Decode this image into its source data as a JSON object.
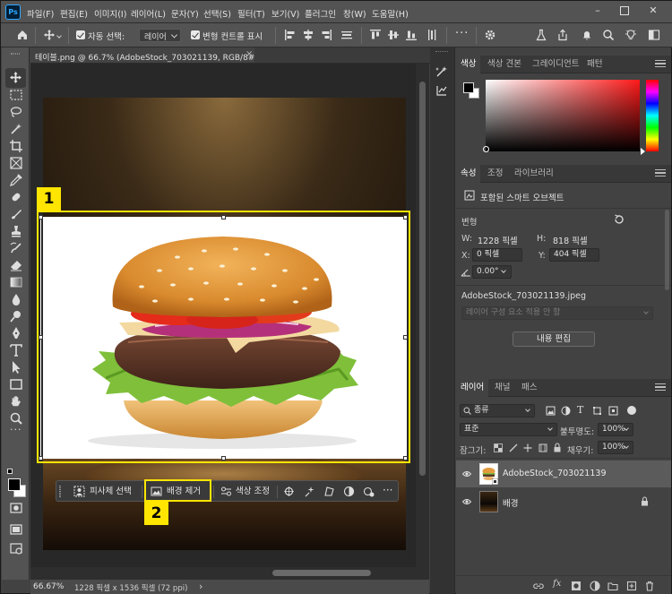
{
  "menu": [
    "파일(F)",
    "편집(E)",
    "이미지(I)",
    "레이어(L)",
    "문자(Y)",
    "선택(S)",
    "필터(T)",
    "보기(V)",
    "플러그인",
    "창(W)",
    "도움말(H)"
  ],
  "options": {
    "auto_select_label": "자동 선택:",
    "auto_select_value": "레이어",
    "transform_controls_label": "변형 컨트롤 표시"
  },
  "document_tab": {
    "title": "테이블.png @ 66.7% (AdobeStock_703021139, RGB/8#) *",
    "close": "×"
  },
  "taskbar": {
    "select_subject": "피사체 선택",
    "remove_background": "배경 제거",
    "adjust_color": "색상 조정",
    "more": "···"
  },
  "callouts": [
    "1",
    "2"
  ],
  "status": {
    "zoom": "66.67%",
    "info": "1228 픽셀 x 1536 픽셀 (72 ppi)",
    "caret": "›"
  },
  "color_panel": {
    "tabs": [
      "색상",
      "색상 견본",
      "그레이디언트",
      "패턴"
    ],
    "accent": "#ff1a1a"
  },
  "properties_panel": {
    "tabs": [
      "속성",
      "조정",
      "라이브러리"
    ],
    "kind": "포함된 스마트 오브젝트",
    "section": "변형",
    "w_label": "W:",
    "w_value": "1228 픽셀",
    "h_label": "H:",
    "h_value": "818 픽셀",
    "x_label": "X:",
    "x_value": "0 픽셀",
    "y_label": "Y:",
    "y_value": "404 픽셀",
    "angle_value": "0.00°",
    "filename": "AdobeStock_703021139.jpeg",
    "comp_placeholder": "레이어 구성 요소 적용 안 함",
    "edit_button": "내용 편집"
  },
  "layers_panel": {
    "tabs": [
      "레이어",
      "채널",
      "패스"
    ],
    "filter_kind": "종류",
    "blend_mode": "표준",
    "opacity_label": "불투명도:",
    "opacity_value": "100%",
    "lock_label": "잠그기:",
    "fill_label": "채우기:",
    "fill_value": "100%",
    "layers": [
      {
        "name": "AdobeStock_703021139",
        "selected": true
      },
      {
        "name": "배경",
        "selected": false
      }
    ],
    "footer_fx": "fx"
  }
}
